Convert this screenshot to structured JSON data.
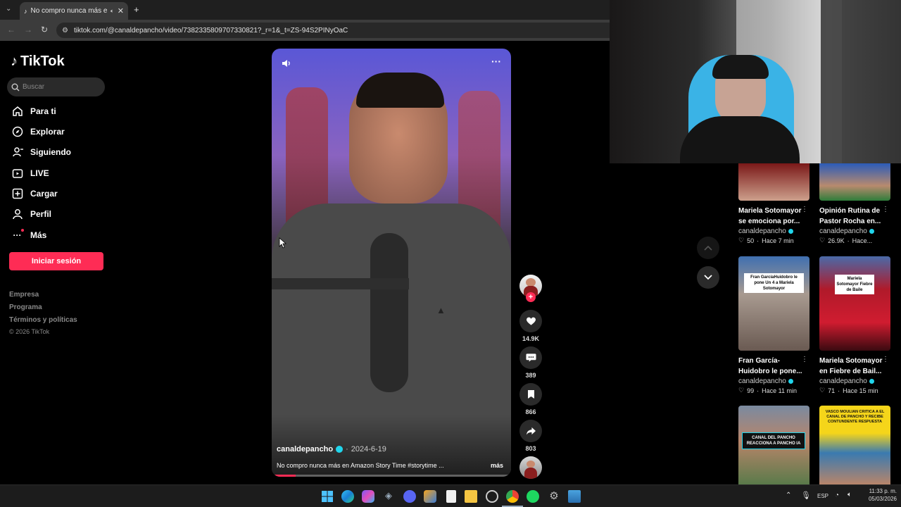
{
  "browser": {
    "tab_title": "No compro nunca más en A",
    "url": "tiktok.com/@canaldepancho/video/7382335809707330821?_r=1&_t=ZS-94S2PINyOaC"
  },
  "sidebar": {
    "logo": "TikTok",
    "search_placeholder": "Buscar",
    "items": [
      {
        "label": "Para ti",
        "icon": "home-icon"
      },
      {
        "label": "Explorar",
        "icon": "compass-icon"
      },
      {
        "label": "Siguiendo",
        "icon": "following-icon"
      },
      {
        "label": "LIVE",
        "icon": "live-icon"
      },
      {
        "label": "Cargar",
        "icon": "upload-icon"
      },
      {
        "label": "Perfil",
        "icon": "profile-icon"
      },
      {
        "label": "Más",
        "icon": "more-icon"
      }
    ],
    "login_button": "Iniciar sesión",
    "footer": [
      "Empresa",
      "Programa",
      "Términos y políticas",
      "© 2026 TikTok"
    ]
  },
  "video": {
    "author": "canaldepancho",
    "date": "2024-6-19",
    "caption": "No compro nunca más en Amazon Story Time #storytime ...",
    "more_label": "más",
    "progress": 0.1
  },
  "actions": {
    "likes": "14.9K",
    "comments": "389",
    "saves": "866",
    "shares": "803"
  },
  "cards": [
    {
      "title": "Mariela Sotomayor se emociona por...",
      "author": "canaldepancho",
      "likes": "50",
      "time": "Hace 7 min",
      "thumb_text": ""
    },
    {
      "title": "Opinión Rutina de Pastor Rocha en...",
      "author": "canaldepancho",
      "likes": "26.9K",
      "time": "Hace...",
      "thumb_text": ""
    },
    {
      "title": "Fran García-Huidobro le pone...",
      "author": "canaldepancho",
      "likes": "99",
      "time": "Hace 11 min",
      "thumb_text": "Fran GarcíaHuidobro le pone Un 4 a Mariela Sotomayor"
    },
    {
      "title": "Mariela Sotomayor en Fiebre de Bail...",
      "author": "canaldepancho",
      "likes": "71",
      "time": "Hace 15 min",
      "thumb_text": "Mariela Sotomayor Fiebre de Baile"
    },
    {
      "title": "",
      "author": "",
      "likes": "",
      "time": "",
      "thumb_text": "CANAL DEL PANCHO REACCIONA A PANCHO IA"
    },
    {
      "title": "",
      "author": "",
      "likes": "",
      "time": "",
      "thumb_text": "VASCO MOULIAN CRITICA A EL CANAL DE PANCHO Y RECIBE CONTUNDENTE RESPUESTA"
    }
  ],
  "taskbar": {
    "language": "ESP",
    "time": "11:33 p. m.",
    "date": "05/03/2026"
  }
}
